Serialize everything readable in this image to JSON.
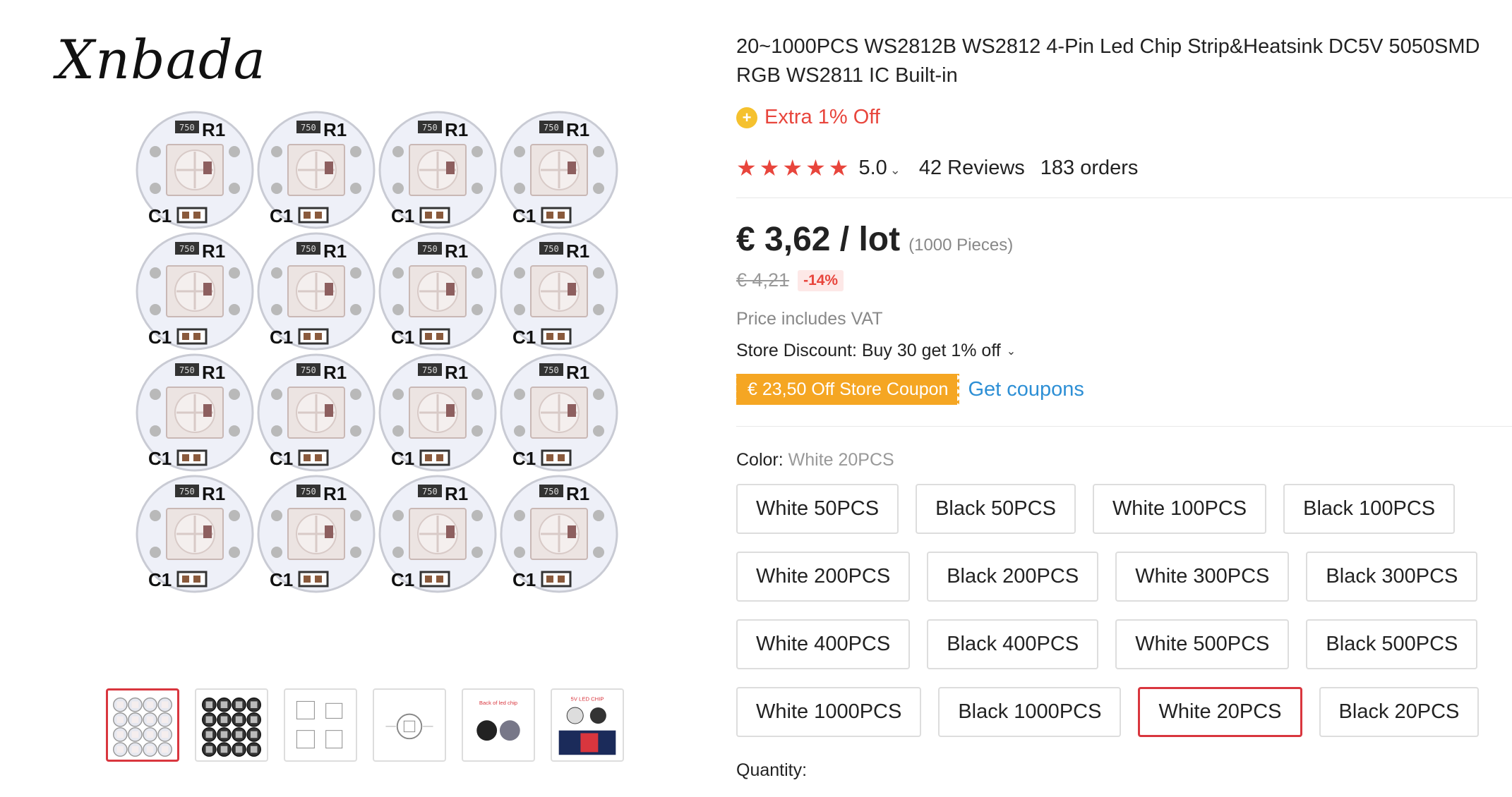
{
  "gallery": {
    "brand": "Xnbada",
    "board_labels": {
      "resistor": "750",
      "r": "R1",
      "c": "C1"
    },
    "thumbnails": [
      {
        "name": "thumb-white-boards",
        "selected": true
      },
      {
        "name": "thumb-black-boards",
        "selected": false
      },
      {
        "name": "thumb-schematic",
        "selected": false
      },
      {
        "name": "thumb-dimensions",
        "selected": false
      },
      {
        "name": "thumb-back-of-chip",
        "selected": false,
        "caption": "Back of led chip"
      },
      {
        "name": "thumb-5v-led-chip",
        "selected": false,
        "caption": "5V LED CHIP"
      }
    ]
  },
  "product": {
    "title": "20~1000PCS WS2812B WS2812 4-Pin Led Chip Strip&Heatsink DC5V 5050SMD RGB WS2811 IC Built-in",
    "extra_off": "Extra 1% Off",
    "rating": {
      "stars": 5,
      "value": "5.0",
      "reviews": "42 Reviews",
      "orders": "183 orders"
    },
    "price": "€ 3,62 / lot",
    "pieces_note": "(1000 Pieces)",
    "original_price": "€ 4,21",
    "discount": "-14%",
    "vat_note": "Price includes VAT",
    "store_discount": "Store Discount: Buy 30 get 1% off",
    "coupon": "€ 23,50 Off Store Coupon",
    "get_coupons": "Get coupons",
    "color_label": "Color:",
    "selected_color": "White 20PCS",
    "sku_rows": [
      [
        "White 50PCS",
        "Black 50PCS",
        "White 100PCS",
        "Black 100PCS"
      ],
      [
        "White 200PCS",
        "Black 200PCS",
        "White 300PCS",
        "Black 300PCS"
      ],
      [
        "White 400PCS",
        "Black 400PCS",
        "White 500PCS",
        "Black 500PCS"
      ],
      [
        "White 1000PCS",
        "Black 1000PCS",
        "White 20PCS",
        "Black 20PCS"
      ]
    ],
    "quantity_label": "Quantity:"
  },
  "colors": {
    "accent_red": "#e8453c",
    "selected_border": "#d9363e",
    "coupon_orange": "#f5a623",
    "link_blue": "#2d8fd5",
    "coin_yellow": "#f5c12e"
  }
}
